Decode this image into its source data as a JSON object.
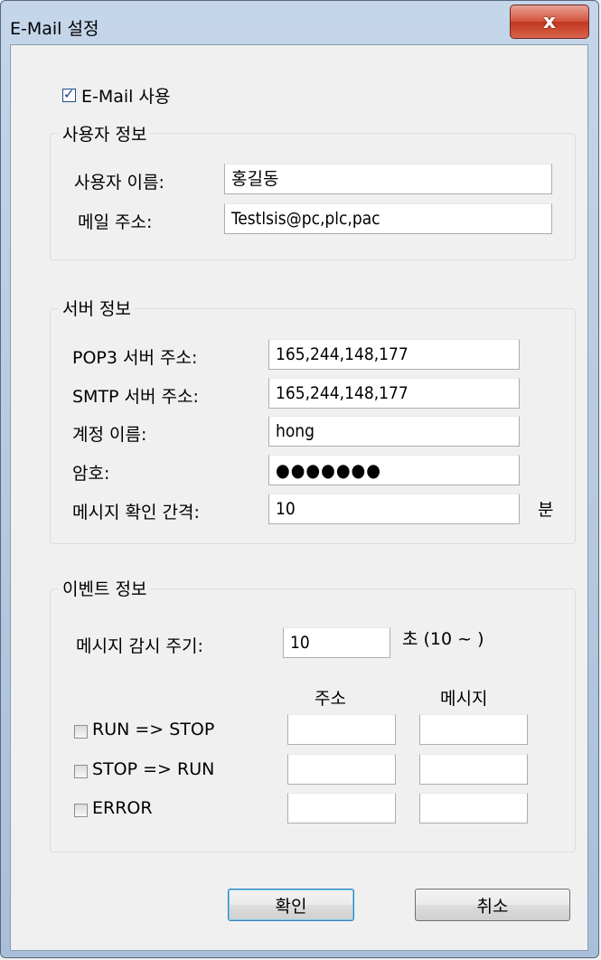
{
  "window": {
    "title": "E-Mail 설정",
    "close_label": "x"
  },
  "use_email": {
    "label": "E-Mail 사용",
    "checked": true
  },
  "user_info": {
    "title": "사용자 정보",
    "name_label": "사용자 이름:",
    "name_value": "홍길동",
    "email_label": "메일 주소:",
    "email_value": "Testlsis@pc,plc,pac"
  },
  "server_info": {
    "title": "서버 정보",
    "pop3_label": "POP3 서버 주소:",
    "pop3_value": "165,244,148,177",
    "smtp_label": "SMTP 서버 주소:",
    "smtp_value": "165,244,148,177",
    "account_label": "계정 이름:",
    "account_value": "hong",
    "password_label": "암호:",
    "password_value": "●●●●●●●",
    "interval_label": "메시지 확인 간격:",
    "interval_value": "10",
    "interval_unit": "분"
  },
  "event_info": {
    "title": "이벤트 정보",
    "monitor_label": "메시지 감시 주기:",
    "monitor_value": "10",
    "monitor_unit": "초 (10 ~ )",
    "col_address": "주소",
    "col_message": "메시지",
    "events": [
      {
        "label": "RUN => STOP",
        "checked": false,
        "address": "",
        "message": ""
      },
      {
        "label": "STOP => RUN",
        "checked": false,
        "address": "",
        "message": ""
      },
      {
        "label": "ERROR",
        "checked": false,
        "address": "",
        "message": ""
      }
    ]
  },
  "buttons": {
    "ok": "확인",
    "cancel": "취소"
  }
}
